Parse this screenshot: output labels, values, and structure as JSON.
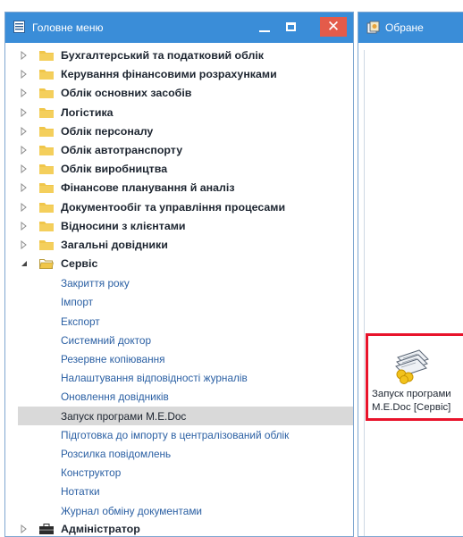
{
  "left_panel": {
    "title": "Головне меню",
    "window_controls": {
      "close_glyph": "✕"
    }
  },
  "tree": {
    "categories": [
      "Бухгалтерський та податковий облік",
      "Керування фінансовими розрахунками",
      "Облік основних засобів",
      "Логістика",
      "Облік персоналу",
      "Облік автотранспорту",
      "Облік виробництва",
      "Фінансове планування й аналіз",
      "Документообіг та управління процесами",
      "Відносини з клієнтами",
      "Загальні довідники"
    ],
    "expanded": {
      "label": "Сервіс",
      "items": [
        "Закриття року",
        "Імпорт",
        "Експорт",
        "Системний доктор",
        "Резервне копіювання",
        "Налаштування відповідності журналів",
        "Оновлення довідників",
        "Запуск програми M.E.Doc",
        "Підготовка до імпорту в централізований облік",
        "Розсилка повідомлень",
        "Конструктор",
        "Нотатки",
        "Журнал обміну документами"
      ],
      "selected_index": 7
    },
    "admin": {
      "label": "Адміністратор"
    }
  },
  "right_panel": {
    "title": "Обране",
    "favorite_tile": {
      "label": "Запуск програми\nM.E.Doc [Сервіс]"
    }
  },
  "colors": {
    "titlebar": "#3a8dd8",
    "close_button": "#e45b4a",
    "folder": "#f0c64a",
    "item_link": "#2a5fa3",
    "selection": "#d9d9d9",
    "highlight_border": "#e8132b"
  },
  "icons": {
    "menu_title": "menu-list-icon",
    "favorites_title": "favorites-icon",
    "folder": "folder-icon",
    "admin": "admin-briefcase-icon",
    "favorite_tile": "medoc-documents-icon"
  }
}
